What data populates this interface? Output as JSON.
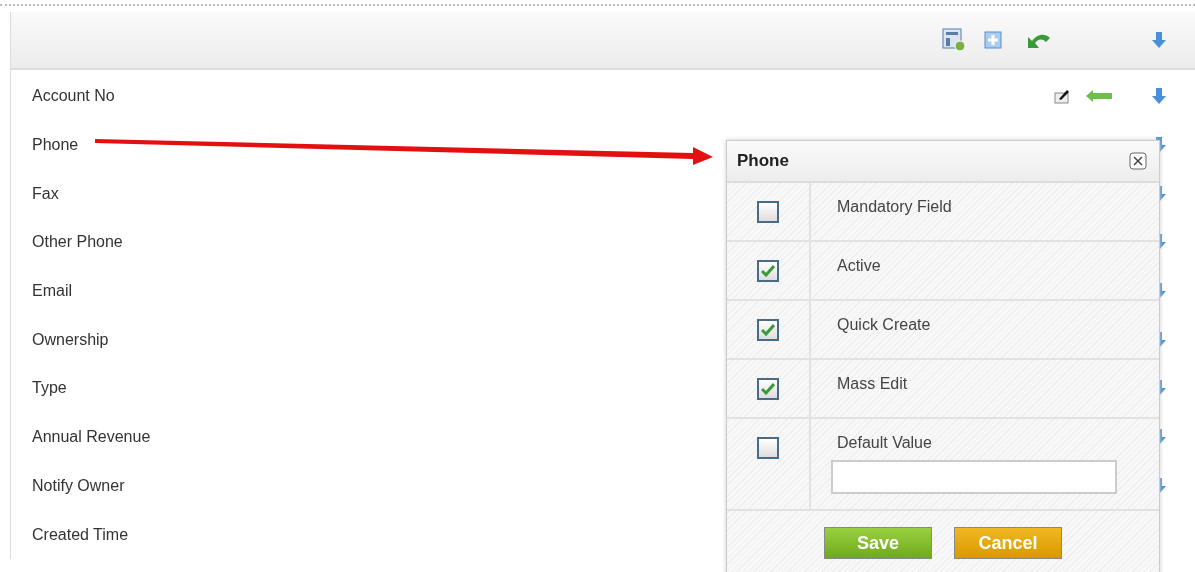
{
  "fields": [
    {
      "label": "Account No",
      "editable": true,
      "movable": true
    },
    {
      "label": "Phone",
      "movable": true
    },
    {
      "label": "Fax",
      "movable": true
    },
    {
      "label": "Other Phone",
      "movable": true
    },
    {
      "label": "Email",
      "movable": true
    },
    {
      "label": "Ownership",
      "movable": true
    },
    {
      "label": "Type",
      "movable": true
    },
    {
      "label": "Annual Revenue",
      "movable": true
    },
    {
      "label": "Notify Owner",
      "movable": true
    },
    {
      "label": "Created Time",
      "movable": false
    }
  ],
  "popup": {
    "title": "Phone",
    "options": [
      {
        "label": "Mandatory Field",
        "checked": false,
        "kind": "check"
      },
      {
        "label": "Active",
        "checked": true,
        "kind": "check"
      },
      {
        "label": "Quick Create",
        "checked": true,
        "kind": "check"
      },
      {
        "label": "Mass Edit",
        "checked": true,
        "kind": "check"
      },
      {
        "label": "Default Value",
        "checked": false,
        "kind": "input"
      }
    ],
    "buttons": [
      {
        "label": "Save",
        "kind": "primary"
      },
      {
        "label": "Cancel",
        "kind": "secondary"
      }
    ]
  }
}
